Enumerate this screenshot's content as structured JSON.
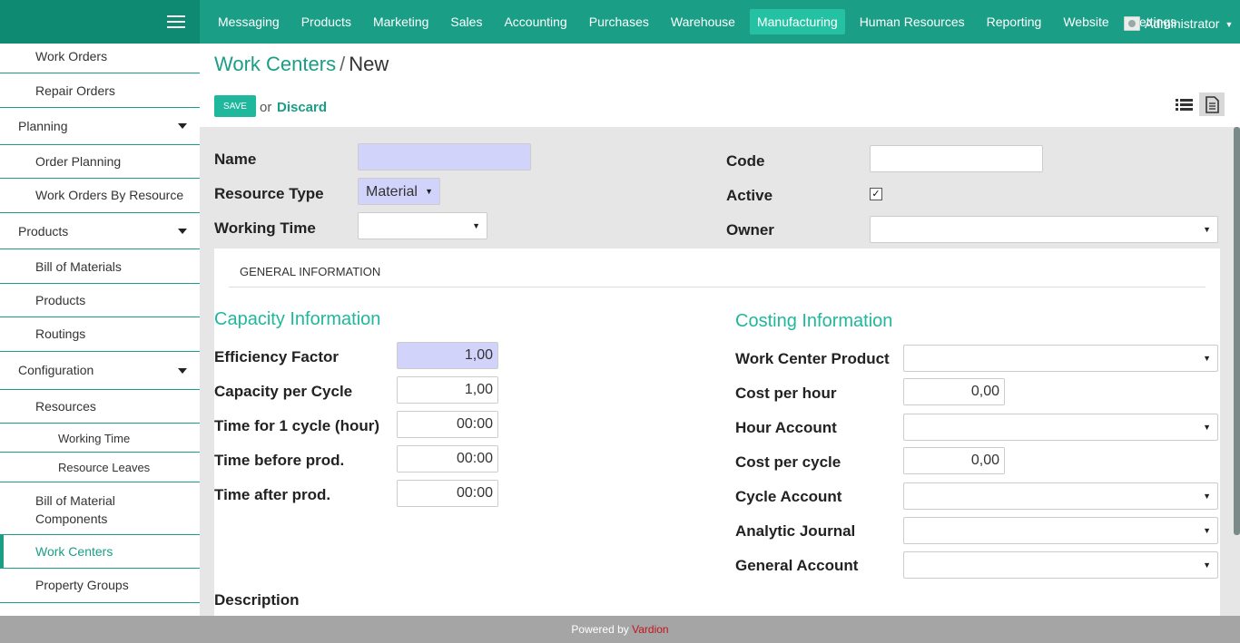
{
  "topbar": {
    "menu": [
      "Messaging",
      "Products",
      "Marketing",
      "Sales",
      "Accounting",
      "Purchases",
      "Warehouse",
      "Manufacturing",
      "Human Resources",
      "Reporting",
      "Website",
      "Settings"
    ],
    "active_menu": "Manufacturing",
    "user": "Administrator",
    "accent_color": "#1a9e86"
  },
  "sidebar": {
    "items": [
      {
        "label": "Work Orders",
        "level": 2
      },
      {
        "label": "Repair Orders",
        "level": 2
      },
      {
        "label": "Planning",
        "level": 1,
        "expandable": true
      },
      {
        "label": "Order Planning",
        "level": 2
      },
      {
        "label": "Work Orders By Resource",
        "level": 2
      },
      {
        "label": "Products",
        "level": 1,
        "expandable": true
      },
      {
        "label": "Bill of Materials",
        "level": 2
      },
      {
        "label": "Products",
        "level": 2
      },
      {
        "label": "Routings",
        "level": 2
      },
      {
        "label": "Configuration",
        "level": 1,
        "expandable": true
      },
      {
        "label": "Resources",
        "level": 2
      },
      {
        "label": "Working Time",
        "level": 3
      },
      {
        "label": "Resource Leaves",
        "level": 3
      },
      {
        "label": "Bill of Material Components",
        "level": 2
      },
      {
        "label": "Work Centers",
        "level": 2,
        "active": true
      },
      {
        "label": "Property Groups",
        "level": 2
      }
    ]
  },
  "header": {
    "breadcrumb_parent": "Work Centers",
    "breadcrumb_sep": "/",
    "breadcrumb_current": "New",
    "save_label": "SAVE",
    "or_label": "or",
    "discard_label": "Discard"
  },
  "form": {
    "name_label": "Name",
    "name_value": "",
    "resource_type_label": "Resource Type",
    "resource_type_value": "Material",
    "working_time_label": "Working Time",
    "working_time_value": "",
    "code_label": "Code",
    "code_value": "",
    "active_label": "Active",
    "active_checked": true,
    "owner_label": "Owner",
    "owner_value": ""
  },
  "notebook": {
    "tab_label": "GENERAL INFORMATION",
    "capacity": {
      "title": "Capacity Information",
      "efficiency_label": "Efficiency Factor",
      "efficiency_value": "1,00",
      "capacity_label": "Capacity per Cycle",
      "capacity_value": "1,00",
      "cycle_time_label": "Time for 1 cycle (hour)",
      "cycle_time_value": "00:00",
      "before_label": "Time before prod.",
      "before_value": "00:00",
      "after_label": "Time after prod.",
      "after_value": "00:00"
    },
    "costing": {
      "title": "Costing Information",
      "product_label": "Work Center Product",
      "cost_hour_label": "Cost per hour",
      "cost_hour_value": "0,00",
      "hour_account_label": "Hour Account",
      "cost_cycle_label": "Cost per cycle",
      "cost_cycle_value": "0,00",
      "cycle_account_label": "Cycle Account",
      "analytic_journal_label": "Analytic Journal",
      "general_account_label": "General Account"
    },
    "description_label": "Description"
  },
  "footer": {
    "powered_label": "Powered by",
    "brand": "Vardion"
  }
}
